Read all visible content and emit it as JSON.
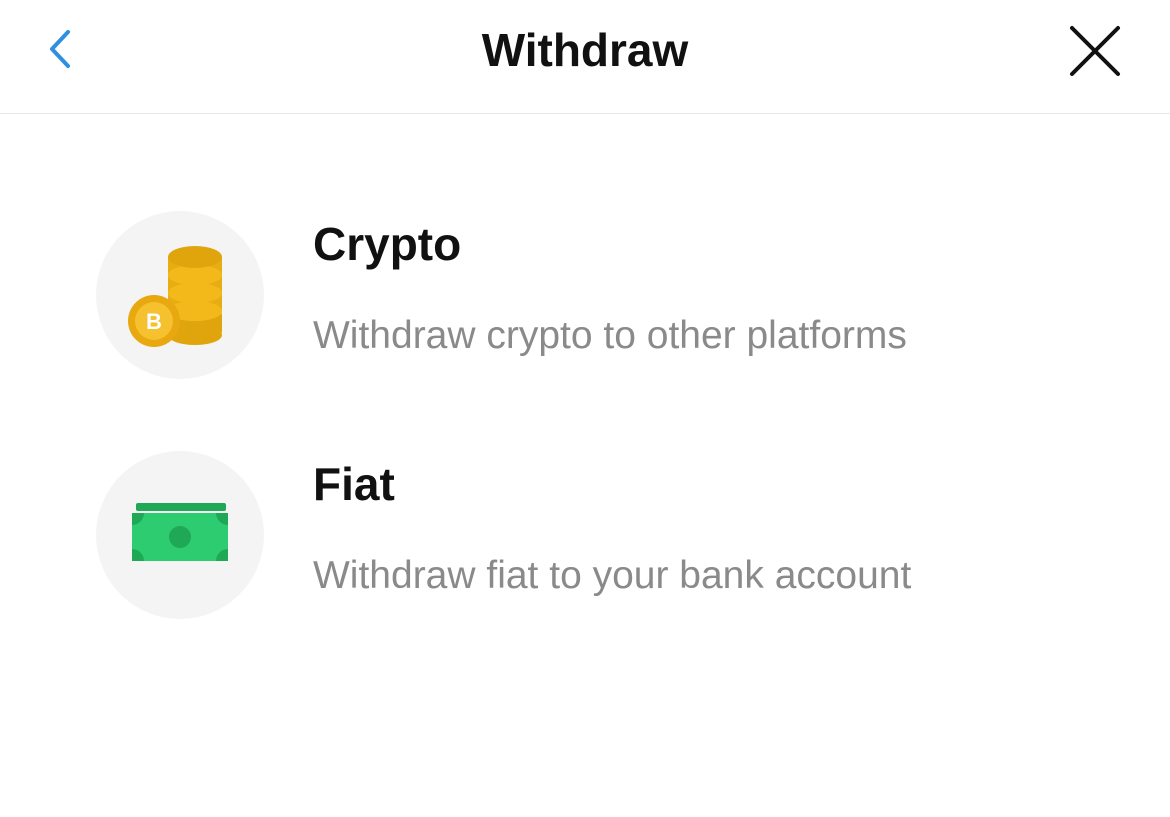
{
  "header": {
    "title": "Withdraw",
    "back_icon": "chevron-left-icon",
    "close_icon": "close-icon",
    "accent_color": "#2f8fe0"
  },
  "options": [
    {
      "title": "Crypto",
      "description": "Withdraw crypto to other platforms",
      "icon": "coins-stack-icon",
      "icon_badge": "B",
      "icon_color": "#f3b91b"
    },
    {
      "title": "Fiat",
      "description": "Withdraw fiat to your bank account",
      "icon": "banknote-icon",
      "icon_color": "#2ecc71"
    }
  ]
}
